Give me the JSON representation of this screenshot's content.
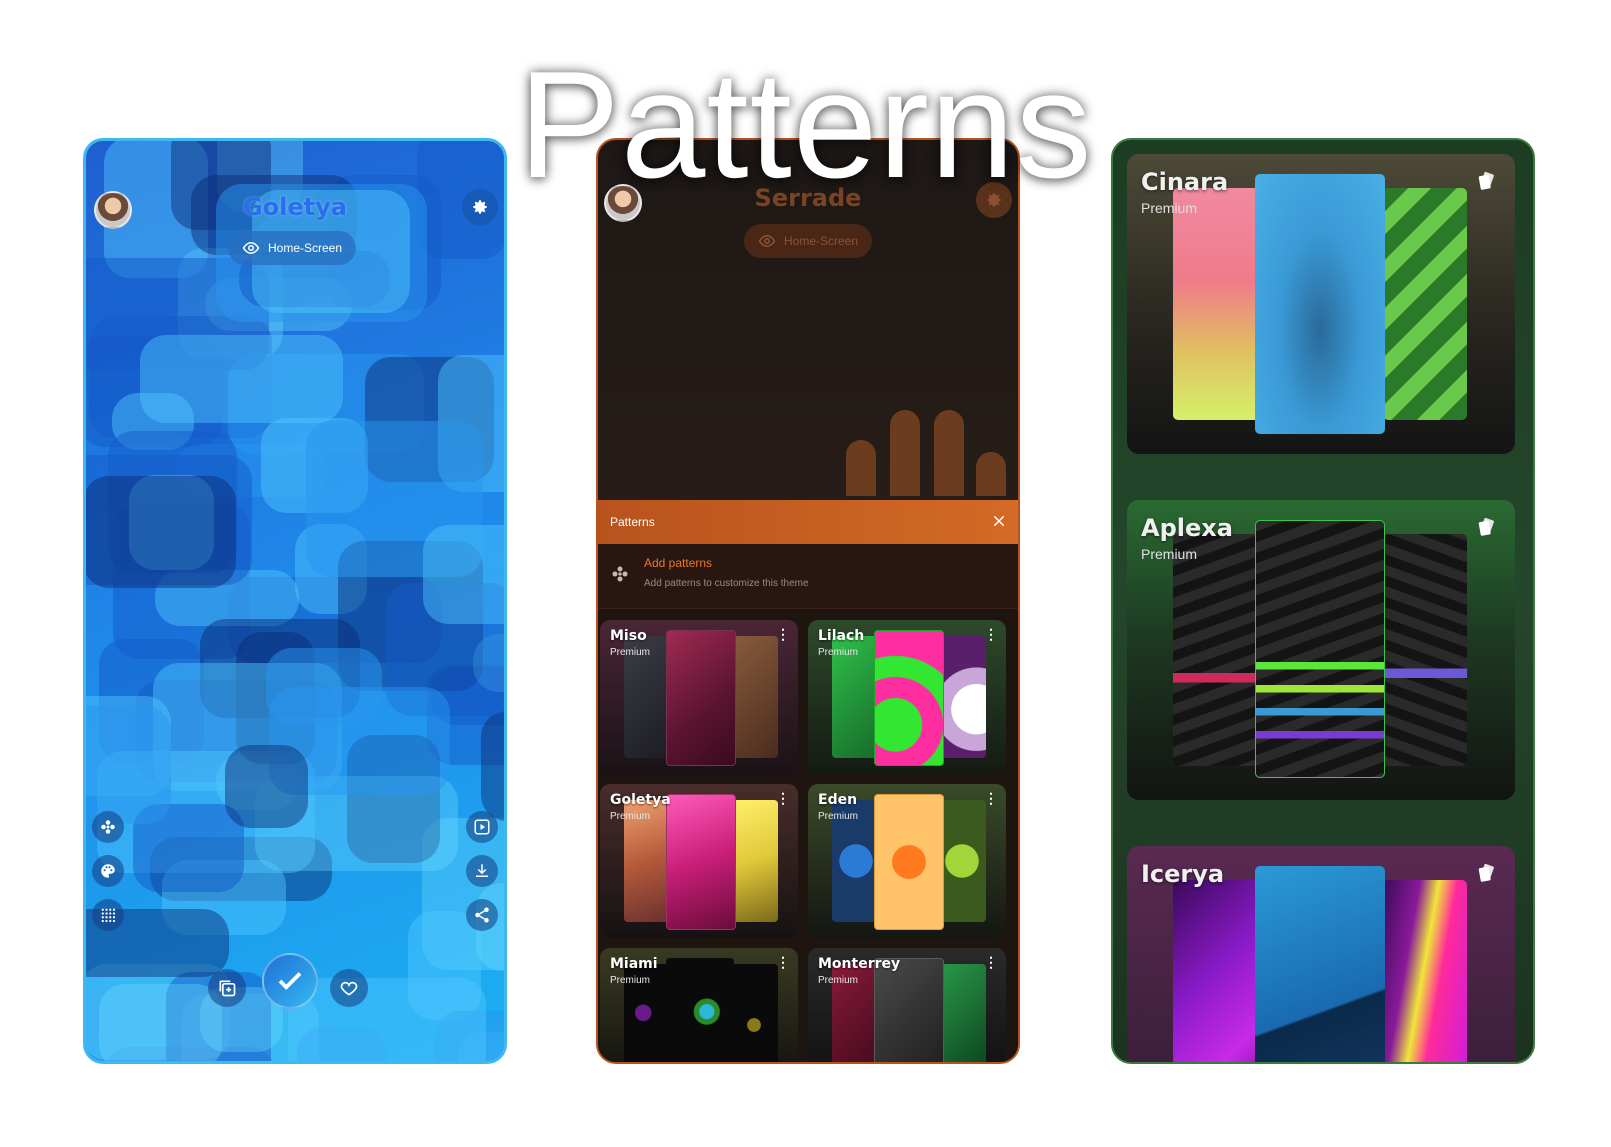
{
  "hero": {
    "title": "Patterns"
  },
  "phone1": {
    "theme_name": "Goletya",
    "home_label": "Home-Screen",
    "accent": "#1f86e8"
  },
  "phone2": {
    "theme_name": "Serrade",
    "home_label": "Home-Screen",
    "sheet_title": "Patterns",
    "add_title": "Add patterns",
    "add_subtitle": "Add patterns to customize this theme",
    "accent": "#d36a25",
    "cards": [
      {
        "name": "Miso",
        "sub": "Premium"
      },
      {
        "name": "Lilach",
        "sub": "Premium"
      },
      {
        "name": "Goletya",
        "sub": "Premium"
      },
      {
        "name": "Eden",
        "sub": "Premium"
      },
      {
        "name": "Miami",
        "sub": "Premium"
      },
      {
        "name": "Monterrey",
        "sub": "Premium"
      }
    ]
  },
  "phone3": {
    "accent": "#3c7a3f",
    "cards": [
      {
        "name": "Cinara",
        "sub": "Premium"
      },
      {
        "name": "Aplexa",
        "sub": "Premium"
      },
      {
        "name": "Icerya",
        "sub": ""
      }
    ]
  }
}
